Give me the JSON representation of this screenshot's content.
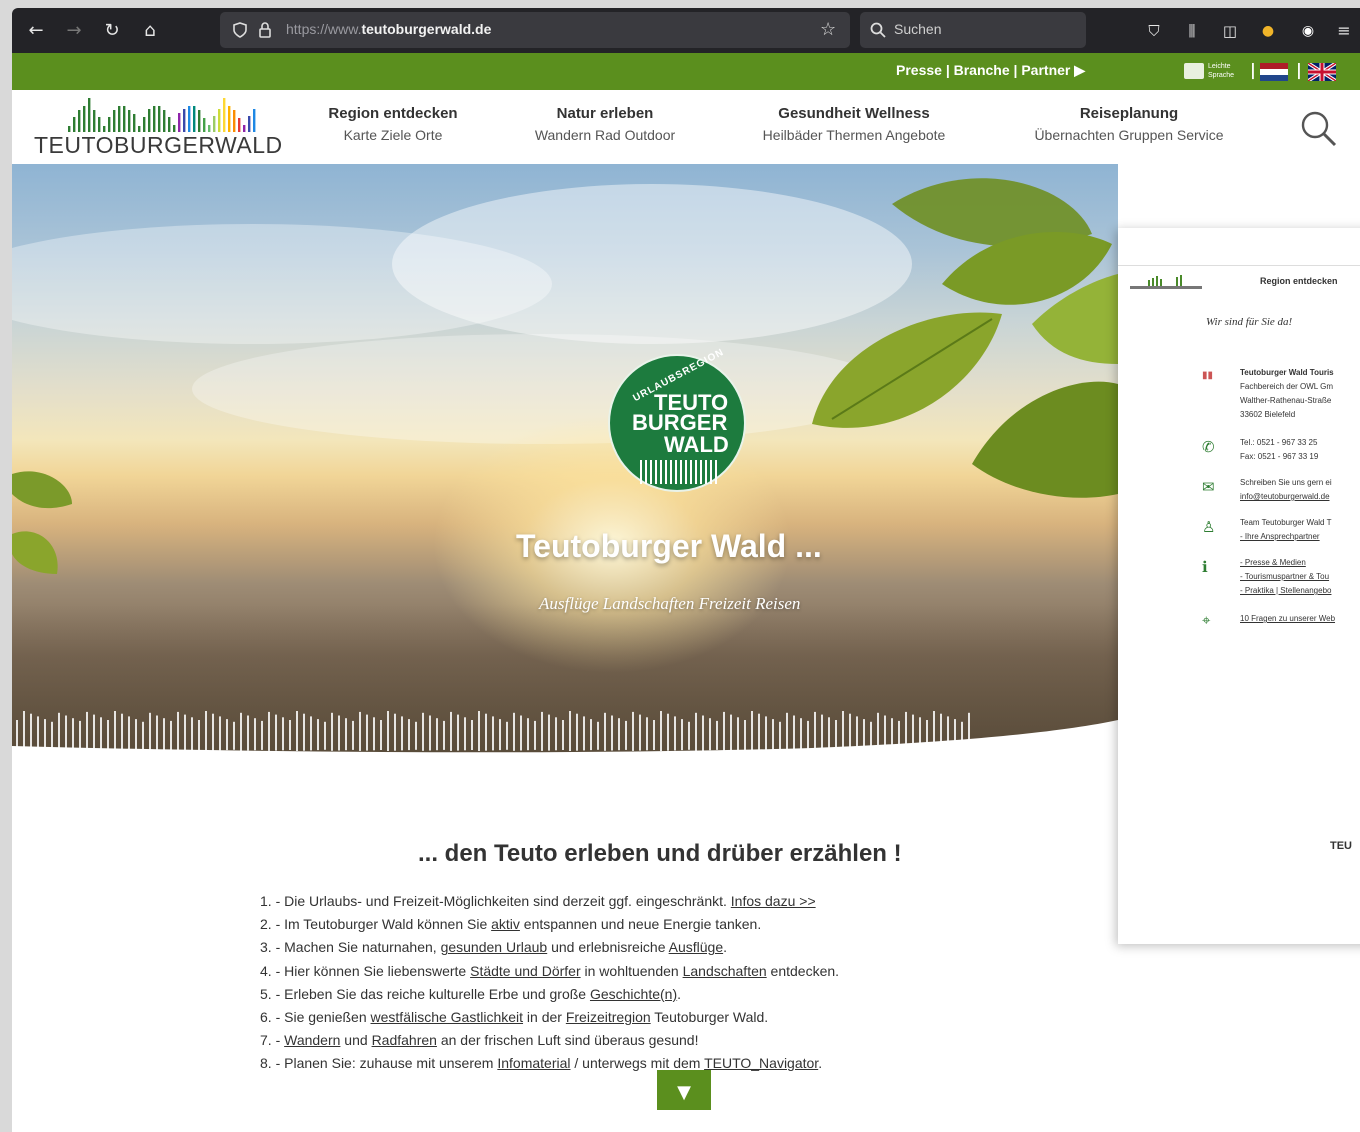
{
  "browser": {
    "url_prefix": "https://www.",
    "url_domain": "teutoburgerwald.de",
    "search_placeholder": "Suchen"
  },
  "topbar": {
    "links": "Presse | Branche | Partner ▶",
    "easy_language": "Leichte Sprache"
  },
  "header": {
    "logo_text": "TEUTOBURGERWALD",
    "nav": [
      {
        "main": "Region entdecken",
        "sub": "Karte Ziele Orte"
      },
      {
        "main": "Natur erleben",
        "sub": "Wandern Rad Outdoor"
      },
      {
        "main": "Gesundheit Wellness",
        "sub": "Heilbäder Thermen Angebote"
      },
      {
        "main": "Reiseplanung",
        "sub": "Übernachten Gruppen Service"
      }
    ]
  },
  "hero": {
    "badge_ring": "URLAUBSREGION",
    "badge_l1": "TEUTO",
    "badge_l2": "BURGER",
    "badge_l3": "WALD",
    "title": "Teutoburger Wald ...",
    "subtitle": "Ausflüge Landschaften Freizeit Reisen"
  },
  "content": {
    "heading": "... den Teuto erleben und drüber erzählen !",
    "items": [
      {
        "pre": "1. - Die Urlaubs- und Freizeit-Möglichkeiten sind derzeit ggf. eingeschränkt. ",
        "link": "Infos dazu >>",
        "post": ""
      },
      {
        "pre": "2. - Im Teutoburger Wald können Sie ",
        "link": "aktiv",
        "post": " entspannen und neue Energie tanken."
      },
      {
        "pre": "3. - Machen Sie naturnahen, ",
        "link": "gesunden Urlaub",
        "mid": " und erlebnisreiche ",
        "link2": "Ausflüge",
        "post": "."
      },
      {
        "pre": "4. - Hier können Sie liebenswerte ",
        "link": "Städte und Dörfer",
        "mid": " in wohltuenden ",
        "link2": "Landschaften",
        "post": " entdecken."
      },
      {
        "pre": "5. - Erleben Sie das reiche kulturelle Erbe und große ",
        "link": "Geschichte(n)",
        "post": "."
      },
      {
        "pre": "6. - Sie genießen ",
        "link": "westfälische Gastlichkeit",
        "mid": " in der ",
        "link2": "Freizeitregion",
        "post": " Teutoburger Wald."
      },
      {
        "pre": "7. - ",
        "link": "Wandern",
        "mid": " und ",
        "link2": "Radfahren",
        "post": " an der frischen Luft sind überaus gesund!"
      },
      {
        "pre": "8. - Planen Sie: zuhause mit unserem ",
        "link": "Infomaterial",
        "mid": " / unterwegs mit dem ",
        "link2": "TEUTO_Navigator",
        "post": "."
      }
    ],
    "down_button": "▼"
  },
  "card": {
    "nav": "Region entdecken",
    "script": "Wir sind für Sie da!",
    "org1": "Teutoburger Wald Touris",
    "org2": "Fachbereich der OWL Gm",
    "org3": "Walther-Rathenau-Straße",
    "org4": "33602 Bielefeld",
    "tel": "Tel.: 0521 - 967 33 25",
    "fax": "Fax: 0521 - 967 33 19",
    "write1": "Schreiben Sie uns gern ei",
    "write2": "info@teutoburgerwald.de",
    "team1": "Team Teutoburger Wald T",
    "team2": "- Ihre Ansprechpartner",
    "info1": "- Presse & Medien",
    "info2": "- Tourismuspartner & Tou",
    "info3": "- Praktika | Stellenangebo",
    "faq": "10 Fragen zu unserer Web",
    "teu": "TEU"
  },
  "colors": {
    "green_bar": "#5b8f1e",
    "badge_green": "#1d7b3e",
    "browser_dark": "#232327"
  }
}
